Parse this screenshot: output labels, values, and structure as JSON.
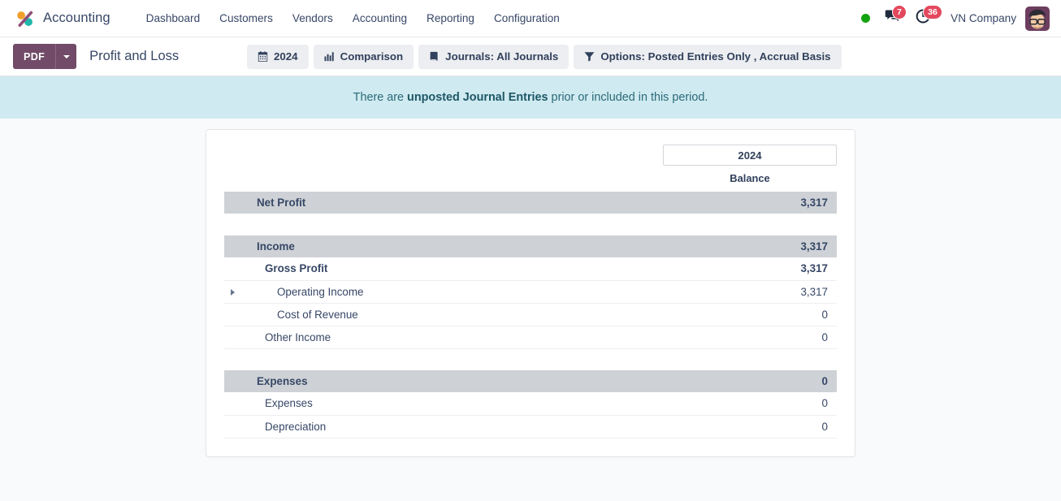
{
  "navbar": {
    "brand": "Accounting",
    "logo_icon": "odoo-logo-icon",
    "menu": [
      {
        "label": "Dashboard"
      },
      {
        "label": "Customers"
      },
      {
        "label": "Vendors"
      },
      {
        "label": "Accounting"
      },
      {
        "label": "Reporting"
      },
      {
        "label": "Configuration"
      }
    ],
    "status_dot_color": "#13a30e",
    "messages": {
      "icon": "chat-bubble-icon",
      "count": "7"
    },
    "activities": {
      "icon": "clock-icon",
      "count": "36"
    },
    "company": "VN Company",
    "avatar_icon": "user-avatar"
  },
  "control_panel": {
    "pdf_label": "PDF",
    "pdf_color": "#714b67",
    "dropdown_icon": "chevron-down-icon",
    "title": "Profit and Loss",
    "filters": [
      {
        "icon": "calendar-icon",
        "label": "2024"
      },
      {
        "icon": "bar-chart-icon",
        "label": "Comparison"
      },
      {
        "icon": "book-icon",
        "label": "Journals: All Journals"
      },
      {
        "icon": "filter-icon",
        "label": "Options: Posted Entries Only , Accrual Basis"
      }
    ]
  },
  "banner": {
    "prefix": "There are ",
    "strong": "unposted Journal Entries",
    "suffix": " prior or included in this period.",
    "background": "#cfeaf0"
  },
  "report": {
    "period_label": "2024",
    "column_header": "Balance",
    "rows": [
      {
        "type": "head",
        "label": "Net Profit",
        "value": "3,317",
        "level": 0,
        "caret": false,
        "muted": false
      },
      {
        "type": "spacer"
      },
      {
        "type": "head",
        "label": "Income",
        "value": "3,317",
        "level": 0,
        "caret": false,
        "muted": false
      },
      {
        "type": "line",
        "label": "Gross Profit",
        "value": "3,317",
        "level": 1,
        "caret": false,
        "bold": true,
        "muted": false
      },
      {
        "type": "line",
        "label": "Operating Income",
        "value": "3,317",
        "level": 2,
        "caret": true,
        "bold": false,
        "muted": false
      },
      {
        "type": "line",
        "label": "Cost of Revenue",
        "value": "0",
        "level": 2,
        "caret": false,
        "bold": false,
        "muted": true
      },
      {
        "type": "line",
        "label": "Other Income",
        "value": "0",
        "level": 1,
        "caret": false,
        "bold": false,
        "muted": true
      },
      {
        "type": "spacer"
      },
      {
        "type": "head",
        "label": "Expenses",
        "value": "0",
        "level": 0,
        "caret": false,
        "muted": true
      },
      {
        "type": "line",
        "label": "Expenses",
        "value": "0",
        "level": 1,
        "caret": false,
        "bold": false,
        "muted": true
      },
      {
        "type": "line",
        "label": "Depreciation",
        "value": "0",
        "level": 1,
        "caret": false,
        "bold": false,
        "muted": true
      }
    ]
  }
}
